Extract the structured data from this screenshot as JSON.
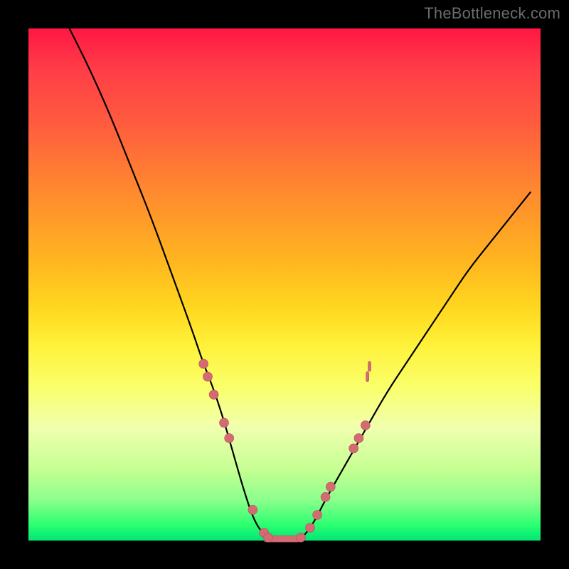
{
  "watermark": "TheBottleneck.com",
  "colors": {
    "dot": "#d36b72",
    "dot_stroke": "#b84f58",
    "curve": "#000000",
    "frame": "#000000"
  },
  "chart_data": {
    "type": "line",
    "title": "",
    "xlabel": "",
    "ylabel": "",
    "xlim": [
      0,
      100
    ],
    "ylim": [
      0,
      100
    ],
    "grid": false,
    "legend": false,
    "series": [
      {
        "name": "bottleneck-curve",
        "x": [
          8,
          12,
          16,
          20,
          24,
          28,
          32,
          34,
          36,
          38,
          40,
          42,
          44,
          46,
          48,
          50,
          52,
          54,
          56,
          58,
          62,
          66,
          70,
          74,
          78,
          82,
          86,
          90,
          94,
          98
        ],
        "y": [
          100,
          92,
          83,
          73,
          63,
          52,
          41,
          35,
          30,
          24,
          17,
          10,
          4,
          1,
          0,
          0,
          0,
          1,
          4,
          8,
          15,
          22,
          29,
          35,
          41,
          47,
          53,
          58,
          63,
          68
        ]
      }
    ],
    "markers_left": [
      {
        "x": 34.2,
        "y": 34.5
      },
      {
        "x": 35.0,
        "y": 32.0
      },
      {
        "x": 36.2,
        "y": 28.5
      },
      {
        "x": 38.2,
        "y": 23.0
      },
      {
        "x": 39.2,
        "y": 20.0
      },
      {
        "x": 43.8,
        "y": 6.0
      },
      {
        "x": 46.0,
        "y": 1.5
      },
      {
        "x": 46.8,
        "y": 0.6
      }
    ],
    "markers_right": [
      {
        "x": 53.2,
        "y": 0.6
      },
      {
        "x": 55.0,
        "y": 2.5
      },
      {
        "x": 56.4,
        "y": 5.0
      },
      {
        "x": 58.0,
        "y": 8.5
      },
      {
        "x": 59.0,
        "y": 10.5
      },
      {
        "x": 63.5,
        "y": 18.0
      },
      {
        "x": 64.5,
        "y": 20.0
      },
      {
        "x": 65.8,
        "y": 22.5
      }
    ],
    "right_ticks": [
      {
        "x": 66.2,
        "y": 32.0
      },
      {
        "x": 66.6,
        "y": 34.0
      }
    ],
    "flat_bottom": {
      "x_start": 46,
      "x_end": 53,
      "y": 0.4
    }
  }
}
